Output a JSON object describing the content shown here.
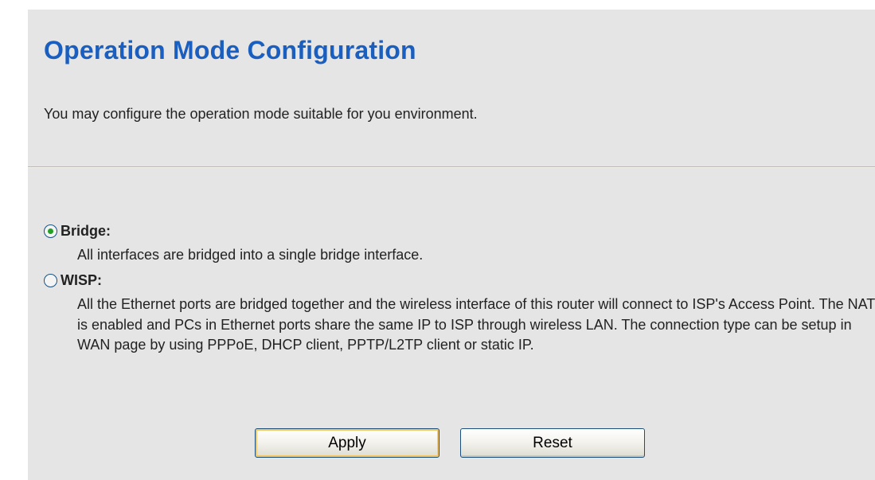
{
  "page": {
    "title": "Operation Mode Configuration",
    "description": "You may configure the operation mode suitable for you environment."
  },
  "modes": {
    "bridge": {
      "label": "Bridge:",
      "description": "All interfaces are bridged into a single bridge interface.",
      "selected": true
    },
    "wisp": {
      "label": "WISP:",
      "description": "All the Ethernet ports are bridged together and the wireless interface of this router will connect to ISP's Access Point. The NAT is enabled and PCs in Ethernet ports share the same IP to ISP through wireless LAN. The connection type can be setup in WAN page by using PPPoE, DHCP client, PPTP/L2TP client or static IP.",
      "selected": false
    }
  },
  "buttons": {
    "apply": "Apply",
    "reset": "Reset"
  },
  "colors": {
    "title": "#1a5fc0",
    "panel_background": "#e5e5e5",
    "radio_selected": "#21a121",
    "apply_focus_ring": "#f4c663"
  }
}
